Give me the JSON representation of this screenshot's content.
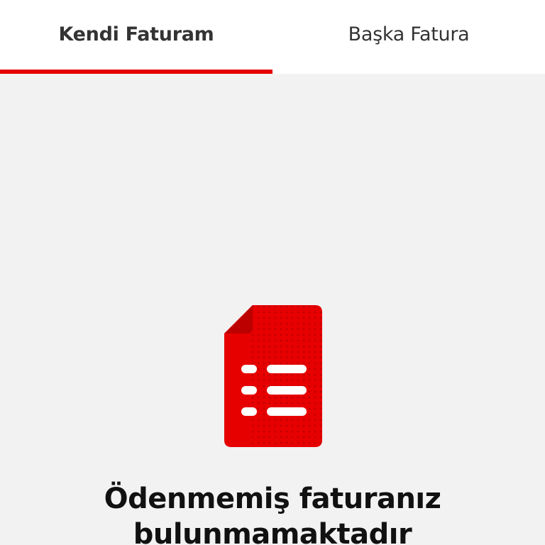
{
  "tabs": [
    {
      "label": "Kendi Faturam",
      "active": true
    },
    {
      "label": "Başka Fatura",
      "active": false
    }
  ],
  "empty_state": {
    "icon": "invoice-document-icon",
    "message_line1": "Ödenmemiş faturanız",
    "message_line2": "bulunmamaktadır"
  },
  "colors": {
    "accent": "#e60000",
    "background": "#f2f2f2",
    "tab_background": "#ffffff",
    "text": "#333333"
  }
}
